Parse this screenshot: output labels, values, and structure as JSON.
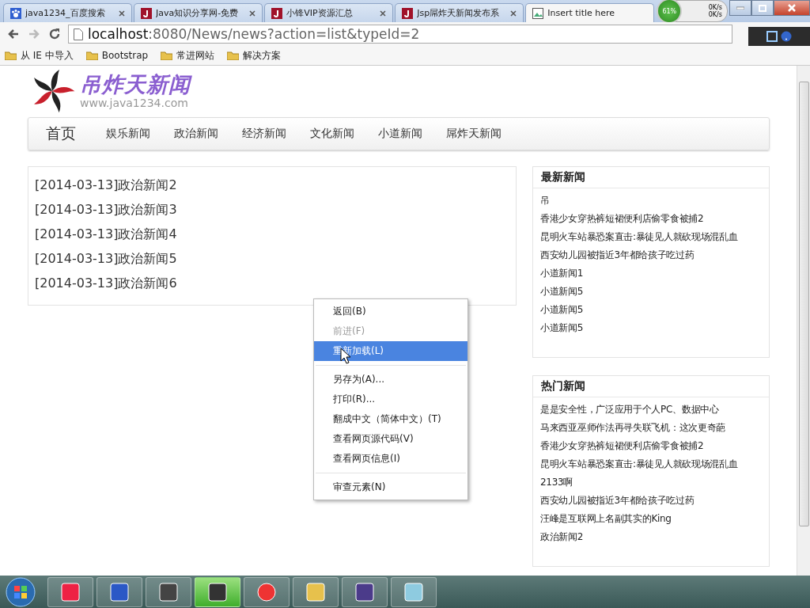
{
  "browser": {
    "tabs": [
      {
        "title": "java1234_百度搜索",
        "selected": false
      },
      {
        "title": "Java知识分享网-免费",
        "selected": false
      },
      {
        "title": "小锋VIP资源汇总",
        "selected": false
      },
      {
        "title": "Jsp屌炸天新闻发布系",
        "selected": false
      },
      {
        "title": "Insert title here",
        "selected": true
      }
    ],
    "net_meter": {
      "percent": "61%",
      "up": "0K/s",
      "down": "0K/s"
    },
    "address": {
      "host": "localhost",
      "rest": ":8080/News/news?action=list&typeId=2"
    },
    "bookmarks": [
      "从 IE 中导入",
      "Bootstrap",
      "常进网站",
      "解决方案"
    ]
  },
  "site": {
    "logo_title": "吊炸天新闻",
    "logo_subtitle": "www.java1234.com",
    "nav": {
      "home": "首页",
      "items": [
        "娱乐新闻",
        "政治新闻",
        "经济新闻",
        "文化新闻",
        "小道新闻",
        "屌炸天新闻"
      ]
    },
    "news_list": [
      "[2014-03-13]政治新闻2",
      "[2014-03-13]政治新闻3",
      "[2014-03-13]政治新闻4",
      "[2014-03-13]政治新闻5",
      "[2014-03-13]政治新闻6"
    ],
    "sidebar": [
      {
        "title": "最新新闻",
        "items": [
          "吊",
          "香港少女穿热裤短裙便利店偷零食被捕2",
          "昆明火车站暴恐案直击:暴徒见人就砍现场混乱血",
          "西安幼儿园被指近3年都给孩子吃过药",
          "小道新闻1",
          "小道新闻5",
          "小道新闻5",
          "小道新闻5"
        ]
      },
      {
        "title": "热门新闻",
        "items": [
          "是是安全性，广泛应用于个人PC、数据中心",
          "马来西亚巫师作法再寻失联飞机：这次更奇葩",
          "香港少女穿热裤短裙便利店偷零食被捕2",
          "昆明火车站暴恐案直击:暴徒见人就砍现场混乱血",
          "2133啊",
          "西安幼儿园被指近3年都给孩子吃过药",
          "汪峰是互联网上名副其实的King",
          "政治新闻2"
        ]
      }
    ]
  },
  "context_menu": [
    {
      "kind": "item",
      "label": "返回(B)",
      "disabled": false,
      "highlighted": false
    },
    {
      "kind": "item",
      "label": "前进(F)",
      "disabled": true,
      "highlighted": false
    },
    {
      "kind": "item",
      "label": "重新加载(L)",
      "disabled": false,
      "highlighted": true
    },
    {
      "kind": "separator"
    },
    {
      "kind": "item",
      "label": "另存为(A)...",
      "disabled": false,
      "highlighted": false
    },
    {
      "kind": "item",
      "label": "打印(R)...",
      "disabled": false,
      "highlighted": false
    },
    {
      "kind": "item",
      "label": "翻成中文（简体中文）(T)",
      "disabled": false,
      "highlighted": false
    },
    {
      "kind": "item",
      "label": "查看网页源代码(V)",
      "disabled": false,
      "highlighted": false
    },
    {
      "kind": "item",
      "label": "查看网页信息(I)",
      "disabled": false,
      "highlighted": false
    },
    {
      "kind": "separator"
    },
    {
      "kind": "item",
      "label": "审查元素(N)",
      "disabled": false,
      "highlighted": false
    }
  ],
  "taskbar": {
    "apps": [
      {
        "active": false
      },
      {
        "active": false
      },
      {
        "active": false
      },
      {
        "active": true
      },
      {
        "active": false
      },
      {
        "active": false
      },
      {
        "active": false
      },
      {
        "active": false
      }
    ]
  }
}
